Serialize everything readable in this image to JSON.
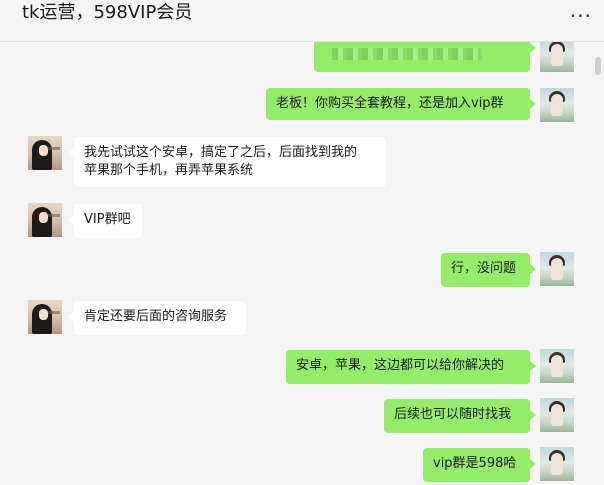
{
  "header": {
    "title": "tk运营，598VIP会员",
    "more_icon": "more-horizontal-icon"
  },
  "messages": [
    {
      "from": "me",
      "text": ""
    },
    {
      "from": "me",
      "text": "老板！你购买全套教程，还是加入vip群"
    },
    {
      "from": "them",
      "line1": "我先试试这个安卓，搞定了之后，后面找到我的",
      "line2": "苹果那个手机，再弄苹果系统"
    },
    {
      "from": "them",
      "text": "VIP群吧"
    },
    {
      "from": "me",
      "text": "行，没问题"
    },
    {
      "from": "them",
      "text": "肯定还要后面的咨询服务"
    },
    {
      "from": "me",
      "text": "安卓，苹果，这边都可以给你解决的"
    },
    {
      "from": "me",
      "text": "后续也可以随时找我"
    },
    {
      "from": "me",
      "text": "vip群是598哈"
    }
  ],
  "colors": {
    "me_bubble": "#95ec69",
    "them_bubble": "#ffffff",
    "background": "#f5f5f5"
  }
}
